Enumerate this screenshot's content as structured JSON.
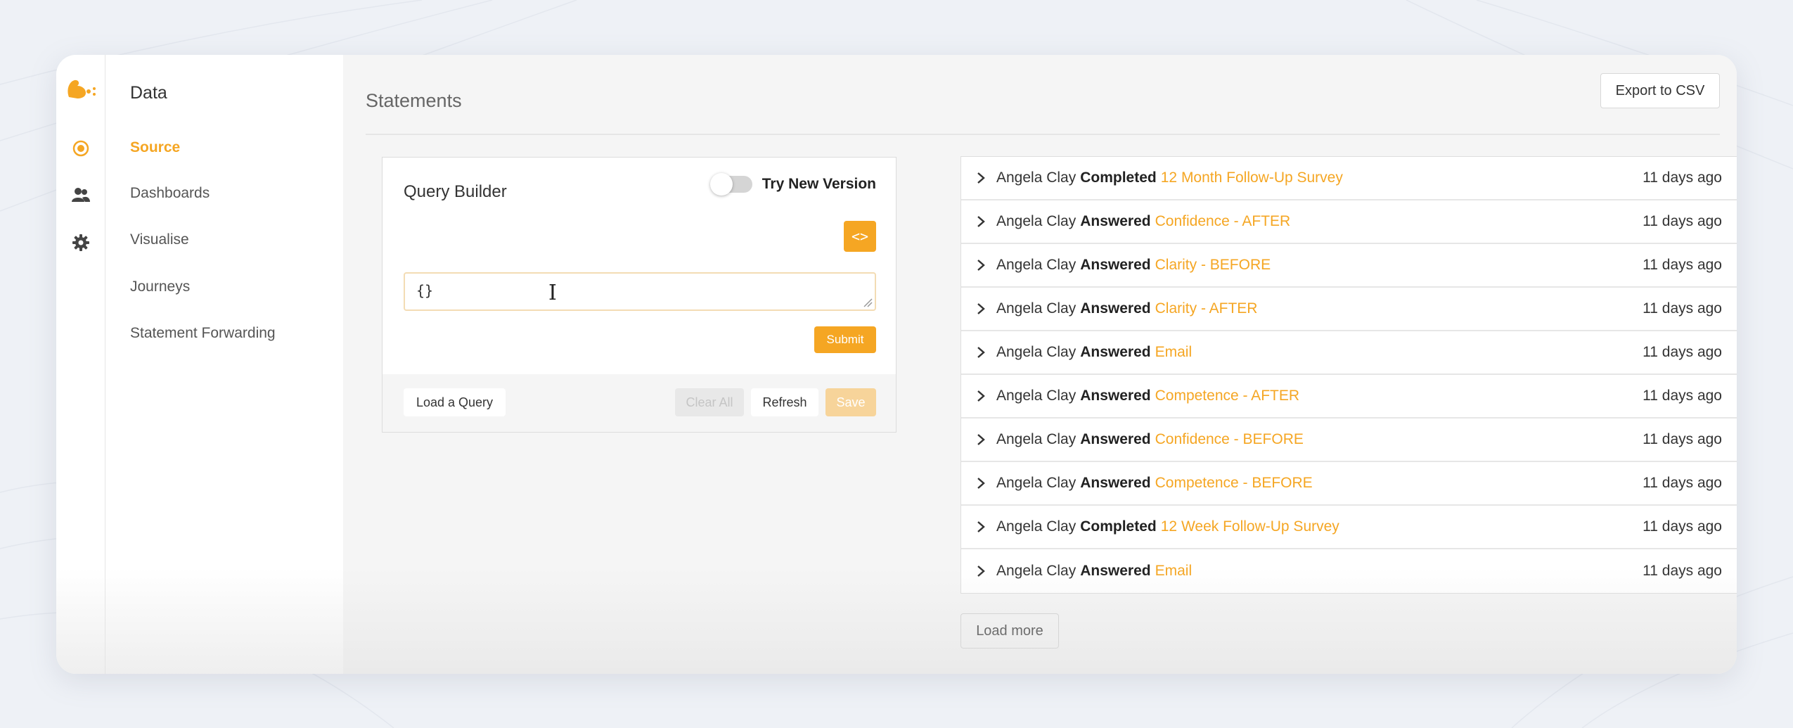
{
  "app": {
    "rail": {
      "icons": [
        "squirrel-logo",
        "source-icon",
        "people-icon",
        "gear-icon"
      ]
    },
    "nav": {
      "title": "Data",
      "items": [
        {
          "label": "Source",
          "active": true
        },
        {
          "label": "Dashboards"
        },
        {
          "label": "Visualise"
        },
        {
          "label": "Journeys"
        },
        {
          "label": "Statement Forwarding"
        }
      ]
    },
    "header": {
      "title": "Statements",
      "export_label": "Export to CSV"
    },
    "query_builder": {
      "title": "Query Builder",
      "toggle_label": "Try New Version",
      "toggle_on": false,
      "code_label": "<>",
      "query_value": "{}",
      "submit_label": "Submit",
      "load_label": "Load a Query",
      "clear_label": "Clear All",
      "refresh_label": "Refresh",
      "save_label": "Save"
    },
    "statements": [
      {
        "actor": "Angela Clay",
        "verb": "Completed",
        "object": "12 Month Follow-Up Survey",
        "time": "11 days ago"
      },
      {
        "actor": "Angela Clay",
        "verb": "Answered",
        "object": "Confidence - AFTER",
        "time": "11 days ago"
      },
      {
        "actor": "Angela Clay",
        "verb": "Answered",
        "object": "Clarity - BEFORE",
        "time": "11 days ago"
      },
      {
        "actor": "Angela Clay",
        "verb": "Answered",
        "object": "Clarity - AFTER",
        "time": "11 days ago"
      },
      {
        "actor": "Angela Clay",
        "verb": "Answered",
        "object": "Email",
        "time": "11 days ago"
      },
      {
        "actor": "Angela Clay",
        "verb": "Answered",
        "object": "Competence - AFTER",
        "time": "11 days ago"
      },
      {
        "actor": "Angela Clay",
        "verb": "Answered",
        "object": "Confidence - BEFORE",
        "time": "11 days ago"
      },
      {
        "actor": "Angela Clay",
        "verb": "Answered",
        "object": "Competence - BEFORE",
        "time": "11 days ago"
      },
      {
        "actor": "Angela Clay",
        "verb": "Completed",
        "object": "12 Week Follow-Up Survey",
        "time": "11 days ago"
      },
      {
        "actor": "Angela Clay",
        "verb": "Answered",
        "object": "Email",
        "time": "11 days ago"
      }
    ],
    "load_more_label": "Load more",
    "colors": {
      "accent": "#f5a623",
      "accent_light": "#f7d49a",
      "text": "#333333"
    }
  }
}
